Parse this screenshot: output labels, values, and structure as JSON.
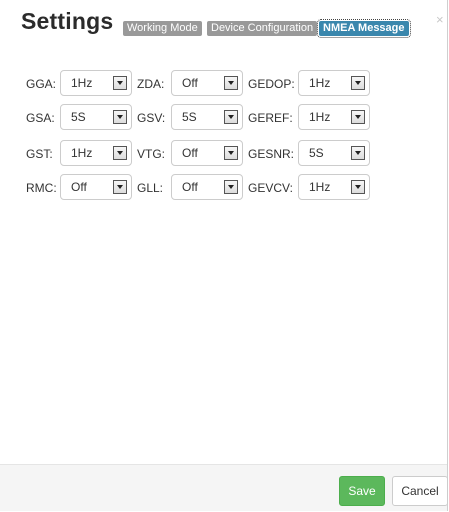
{
  "header": {
    "title": "Settings",
    "tabs": [
      {
        "label": "Working Mode"
      },
      {
        "label": "Device Configuration"
      },
      {
        "label": "NMEA Message"
      }
    ],
    "close_label": "×"
  },
  "rows": [
    [
      {
        "label": "GGA:",
        "value": "1Hz"
      },
      {
        "label": "ZDA:",
        "value": "Off"
      },
      {
        "label": "GEDOP:",
        "value": "1Hz"
      }
    ],
    [
      {
        "label": "GSA:",
        "value": "5S"
      },
      {
        "label": "GSV:",
        "value": "5S"
      },
      {
        "label": "GEREF:",
        "value": "1Hz"
      }
    ],
    [
      {
        "label": "GST:",
        "value": "1Hz"
      },
      {
        "label": "VTG:",
        "value": "Off"
      },
      {
        "label": "GESNR:",
        "value": "5S"
      }
    ],
    [
      {
        "label": "RMC:",
        "value": "Off"
      },
      {
        "label": "GLL:",
        "value": "Off"
      },
      {
        "label": "GEVCV:",
        "value": "1Hz"
      }
    ]
  ],
  "footer": {
    "save_label": "Save",
    "cancel_label": "Cancel"
  }
}
